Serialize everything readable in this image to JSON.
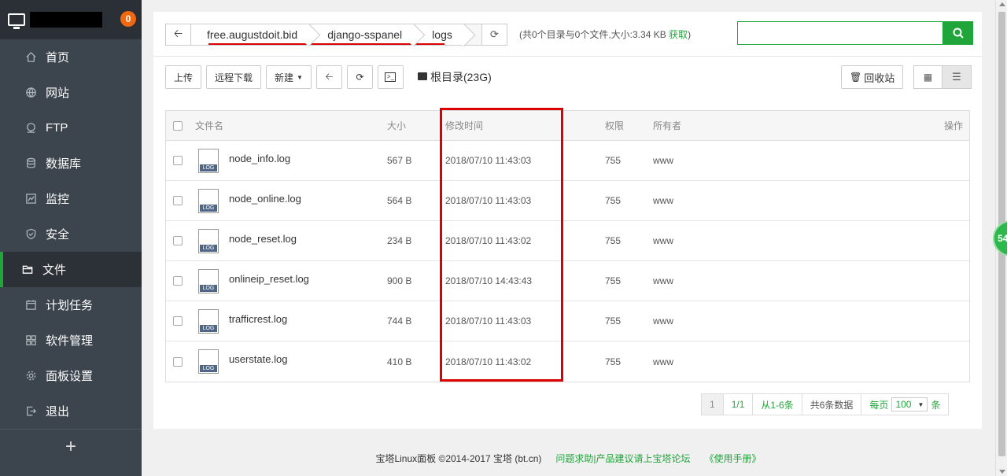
{
  "sidebar": {
    "badge": "0",
    "items": [
      {
        "label": "首页",
        "icon": "home-icon"
      },
      {
        "label": "网站",
        "icon": "globe-icon"
      },
      {
        "label": "FTP",
        "icon": "ftp-icon"
      },
      {
        "label": "数据库",
        "icon": "database-icon"
      },
      {
        "label": "监控",
        "icon": "monitor-icon"
      },
      {
        "label": "安全",
        "icon": "shield-icon"
      },
      {
        "label": "文件",
        "icon": "folder-icon",
        "active": true
      },
      {
        "label": "计划任务",
        "icon": "calendar-icon"
      },
      {
        "label": "软件管理",
        "icon": "grid-icon"
      },
      {
        "label": "面板设置",
        "icon": "gear-icon"
      },
      {
        "label": "退出",
        "icon": "logout-icon"
      }
    ],
    "add_label": "+"
  },
  "path": {
    "crumbs": [
      "free.augustdoit.bid",
      "django-sspanel",
      "logs"
    ]
  },
  "info": {
    "text": "(共0个目录与0个文件,大小:3.34 KB ",
    "link": "获取",
    "close": ")"
  },
  "toolbar": {
    "upload": "上传",
    "remote_download": "远程下载",
    "new": "新建",
    "disk": "根目录(23G)",
    "recycle": "回收站"
  },
  "table": {
    "headers": {
      "name": "文件名",
      "size": "大小",
      "mtime": "修改时间",
      "perm": "权限",
      "owner": "所有者",
      "ops": "操作"
    },
    "rows": [
      {
        "name": "node_info.log",
        "size": "567 B",
        "mtime": "2018/07/10 11:43:03",
        "perm": "755",
        "owner": "www"
      },
      {
        "name": "node_online.log",
        "size": "564 B",
        "mtime": "2018/07/10 11:43:03",
        "perm": "755",
        "owner": "www"
      },
      {
        "name": "node_reset.log",
        "size": "234 B",
        "mtime": "2018/07/10 11:43:02",
        "perm": "755",
        "owner": "www"
      },
      {
        "name": "onlineip_reset.log",
        "size": "900 B",
        "mtime": "2018/07/10 14:43:43",
        "perm": "755",
        "owner": "www"
      },
      {
        "name": "trafficrest.log",
        "size": "744 B",
        "mtime": "2018/07/10 11:43:03",
        "perm": "755",
        "owner": "www"
      },
      {
        "name": "userstate.log",
        "size": "410 B",
        "mtime": "2018/07/10 11:43:02",
        "perm": "755",
        "owner": "www"
      }
    ]
  },
  "pager": {
    "current": "1",
    "pages": "1/1",
    "range": "从1-6条",
    "total": "共6条数据",
    "per_page_prefix": "每页",
    "per_page": "100",
    "per_page_suffix": "条"
  },
  "footer": {
    "copyright": "宝塔Linux面板 ©2014-2017 宝塔 (bt.cn)",
    "help": "问题求助|产品建议请上宝塔论坛",
    "manual": "《使用手册》"
  },
  "float_badge": "54",
  "colors": {
    "accent": "#20a53a",
    "sidebar": "#3c444d",
    "highlight": "#dd0000"
  }
}
